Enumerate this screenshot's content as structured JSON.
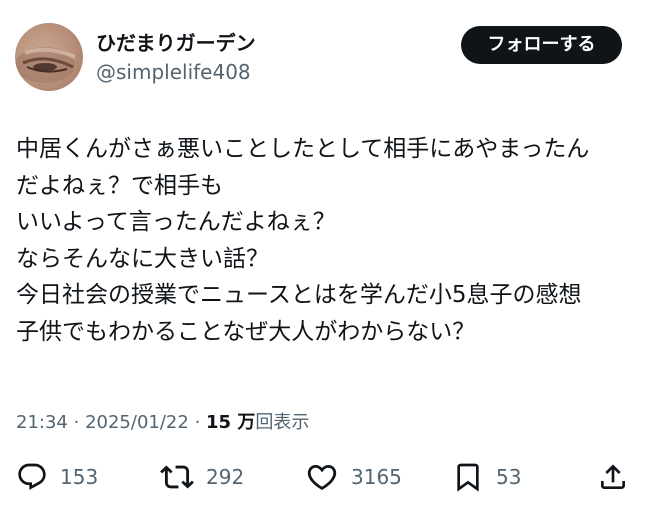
{
  "author": {
    "display_name": "ひだまりガーデン",
    "handle": "@simplelife408"
  },
  "follow_button": {
    "label": "フォローする"
  },
  "tweet": {
    "lines": [
      "中居くんがさぁ悪いことしたとして相手にあやまったん",
      "だよねぇ？で相手も",
      "いいよって言ったんだよねぇ？",
      "ならそんなに大きい話？",
      "今日社会の授業でニュースとはを学んだ小5息子の感想",
      "子供でもわかることなぜ大人がわからない？"
    ]
  },
  "meta": {
    "time": "21:34",
    "separator": "·",
    "date": "2025/01/22",
    "views_count": "15 万",
    "views_label": "回表示"
  },
  "actions": {
    "replies": "153",
    "reposts": "292",
    "likes": "3165",
    "bookmarks": "53"
  },
  "icons": {
    "reply": "reply-icon",
    "repost": "repost-icon",
    "like": "heart-icon",
    "bookmark": "bookmark-icon",
    "share": "share-icon"
  }
}
